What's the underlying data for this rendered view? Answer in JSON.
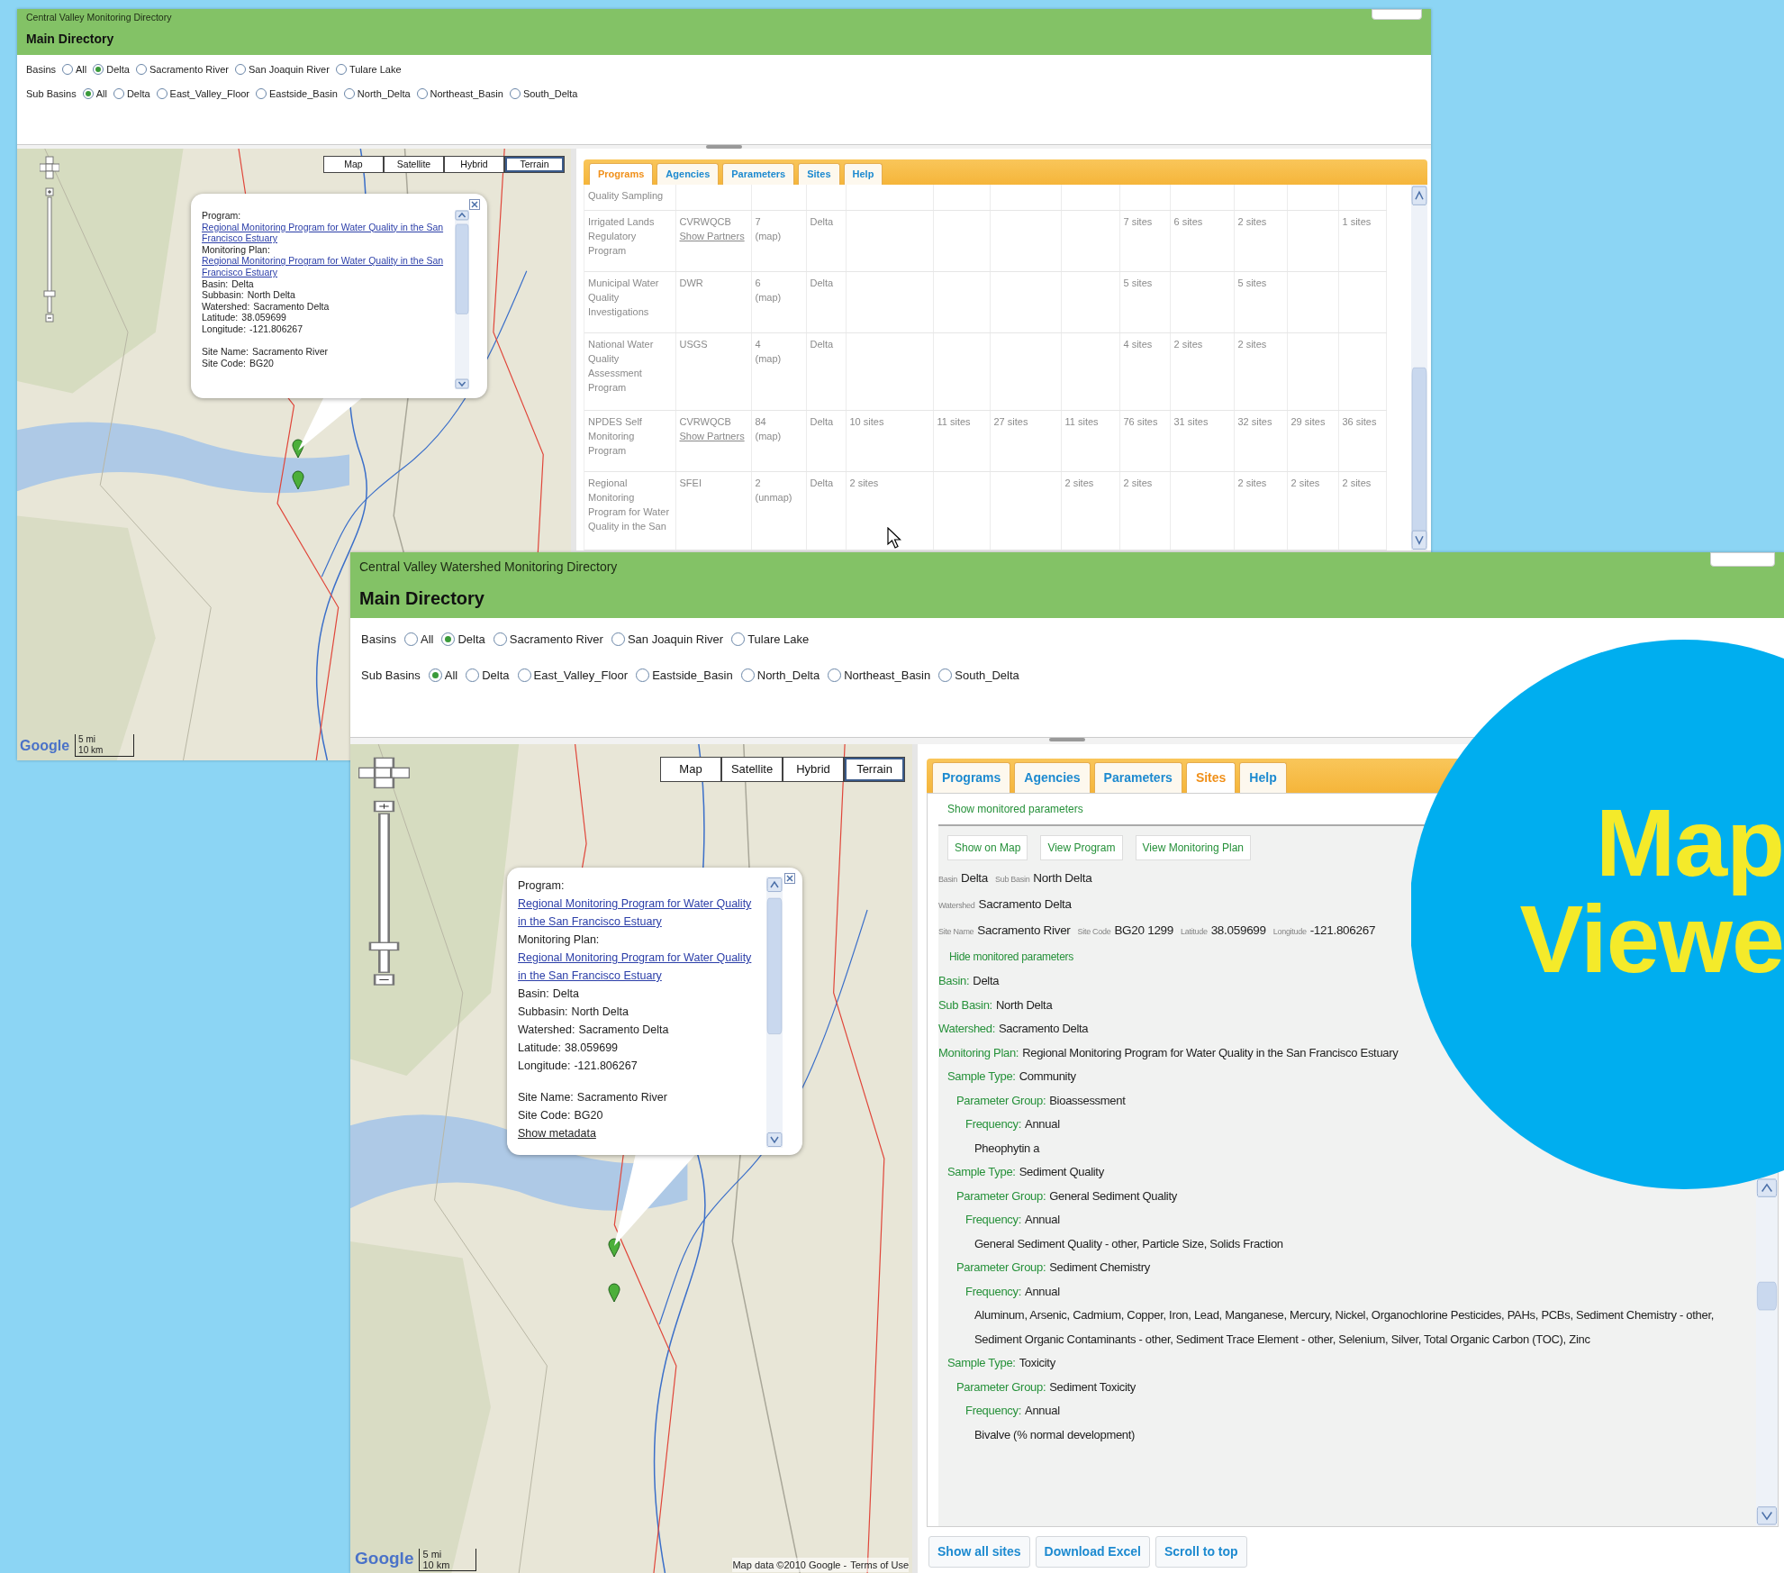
{
  "windows": [
    {
      "title": "Central Valley Monitoring Directory",
      "heading": "Main Directory",
      "filters": [
        {
          "label": "Basins",
          "options": [
            {
              "label": "All",
              "selected": false
            },
            {
              "label": "Delta",
              "selected": true
            },
            {
              "label": "Sacramento River",
              "selected": false
            },
            {
              "label": "San Joaquin River",
              "selected": false
            },
            {
              "label": "Tulare Lake",
              "selected": false
            }
          ]
        },
        {
          "label": "Sub Basins",
          "options": [
            {
              "label": "All",
              "selected": true
            },
            {
              "label": "Delta",
              "selected": false
            },
            {
              "label": "East_Valley_Floor",
              "selected": false
            },
            {
              "label": "Eastside_Basin",
              "selected": false
            },
            {
              "label": "North_Delta",
              "selected": false
            },
            {
              "label": "Northeast_Basin",
              "selected": false
            },
            {
              "label": "South_Delta",
              "selected": false
            }
          ]
        }
      ],
      "map": {
        "map_types": [
          {
            "label": "Map",
            "selected": false
          },
          {
            "label": "Satellite",
            "selected": false
          },
          {
            "label": "Hybrid",
            "selected": false
          },
          {
            "label": "Terrain",
            "selected": true
          }
        ],
        "popup": [
          {
            "kind": "link",
            "label": "Program:",
            "value": "Regional Monitoring Program for Water Quality in the San Francisco Estuary"
          },
          {
            "kind": "link",
            "label": "Monitoring Plan:",
            "value": "Regional Monitoring Program for Water Quality in the San Francisco Estuary"
          },
          {
            "kind": "text",
            "label": "Basin:",
            "value": "Delta"
          },
          {
            "kind": "text",
            "label": "Subbasin:",
            "value": "North Delta"
          },
          {
            "kind": "text",
            "label": "Watershed:",
            "value": "Sacramento Delta"
          },
          {
            "kind": "text",
            "label": "Latitude:",
            "value": "38.059699"
          },
          {
            "kind": "text",
            "label": "Longitude:",
            "value": "-121.806267"
          },
          {
            "kind": "gap"
          },
          {
            "kind": "text",
            "label": "Site Name:",
            "value": "Sacramento River"
          },
          {
            "kind": "text",
            "label": "Site Code:",
            "value": "BG20"
          }
        ],
        "logo": "Google",
        "scale_miles": "5 mi",
        "scale_km": "10 km"
      },
      "panel": {
        "kind": "programs",
        "tabs": [
          {
            "label": "Programs",
            "selected": true
          },
          {
            "label": "Agencies",
            "selected": false
          },
          {
            "label": "Parameters",
            "selected": false
          },
          {
            "label": "Sites",
            "selected": false
          },
          {
            "label": "Help",
            "selected": false
          }
        ],
        "rows": [
          {
            "program": "Quality Sampling"
          },
          {
            "program": "Irrigated Lands Regulatory Program",
            "agency": "CVRWQCB",
            "partners_link": "Show Partners",
            "count": "7",
            "map_link": "(map)",
            "basin": "Delta",
            "column_5": "7 sites",
            "column_6": "6 sites",
            "column_7": "2 sites",
            "column_9": "1 sites"
          },
          {
            "program": "Municipal Water Quality Investigations",
            "agency": "DWR",
            "count": "6",
            "map_link": "(map)",
            "basin": "Delta",
            "column_5": "5 sites",
            "column_7": "5 sites"
          },
          {
            "program": "National Water Quality Assessment Program",
            "agency": "USGS",
            "count": "4",
            "map_link": "(map)",
            "basin": "Delta",
            "column_5": "4 sites",
            "column_6": "2 sites",
            "column_7": "2 sites"
          },
          {
            "program": "NPDES Self Monitoring Program",
            "agency": "CVRWQCB",
            "partners_link": "Show Partners",
            "count": "84",
            "map_link": "(map)",
            "basin": "Delta",
            "column_1": "10 sites",
            "column_2": "11 sites",
            "column_3": "27 sites",
            "column_4": "11 sites",
            "column_5": "76 sites",
            "column_6": "31 sites",
            "column_7": "32 sites",
            "column_8": "29 sites",
            "column_9": "36 sites"
          },
          {
            "program": "Regional Monitoring Program for Water Quality in the San",
            "agency": "SFEI",
            "count": "2",
            "map_link": "(unmap)",
            "basin": "Delta",
            "column_1": "2 sites",
            "column_4": "2 sites",
            "column_5": "2 sites",
            "column_7": "2 sites",
            "column_8": "2 sites",
            "column_9": "2 sites"
          }
        ]
      }
    },
    {
      "title": "Central Valley Watershed Monitoring Directory",
      "heading": "Main Directory",
      "filters": [
        {
          "label": "Basins",
          "options": [
            {
              "label": "All",
              "selected": false
            },
            {
              "label": "Delta",
              "selected": true
            },
            {
              "label": "Sacramento River",
              "selected": false
            },
            {
              "label": "San Joaquin River",
              "selected": false
            },
            {
              "label": "Tulare Lake",
              "selected": false
            }
          ]
        },
        {
          "label": "Sub Basins",
          "options": [
            {
              "label": "All",
              "selected": true
            },
            {
              "label": "Delta",
              "selected": false
            },
            {
              "label": "East_Valley_Floor",
              "selected": false
            },
            {
              "label": "Eastside_Basin",
              "selected": false
            },
            {
              "label": "North_Delta",
              "selected": false
            },
            {
              "label": "Northeast_Basin",
              "selected": false
            },
            {
              "label": "South_Delta",
              "selected": false
            }
          ]
        }
      ],
      "map": {
        "map_types": [
          {
            "label": "Map",
            "selected": false
          },
          {
            "label": "Satellite",
            "selected": false
          },
          {
            "label": "Hybrid",
            "selected": false
          },
          {
            "label": "Terrain",
            "selected": true
          }
        ],
        "popup": [
          {
            "kind": "link",
            "label": "Program:",
            "value": "Regional Monitoring Program for Water Quality in the San Francisco Estuary"
          },
          {
            "kind": "link",
            "label": "Monitoring Plan:",
            "value": "Regional Monitoring Program for Water Quality in the San Francisco Estuary"
          },
          {
            "kind": "text",
            "label": "Basin:",
            "value": "Delta"
          },
          {
            "kind": "text",
            "label": "Subbasin:",
            "value": "North Delta"
          },
          {
            "kind": "text",
            "label": "Watershed:",
            "value": "Sacramento Delta"
          },
          {
            "kind": "text",
            "label": "Latitude:",
            "value": "38.059699"
          },
          {
            "kind": "text",
            "label": "Longitude:",
            "value": "-121.806267"
          },
          {
            "kind": "gap"
          },
          {
            "kind": "text",
            "label": "Site Name:",
            "value": "Sacramento River"
          },
          {
            "kind": "text",
            "label": "Site Code:",
            "value": "BG20"
          },
          {
            "kind": "action",
            "value": "Show metadata"
          }
        ],
        "logo": "Google",
        "scale_miles": "5 mi",
        "scale_km": "10 km",
        "attribution": "Map data ©2010 Google -",
        "terms_link": "Terms of Use"
      },
      "panel": {
        "kind": "sites",
        "tabs": [
          {
            "label": "Programs",
            "selected": false
          },
          {
            "label": "Agencies",
            "selected": false
          },
          {
            "label": "Parameters",
            "selected": false
          },
          {
            "label": "Sites",
            "selected": true
          },
          {
            "label": "Help",
            "selected": false
          }
        ],
        "show_link": "Show monitored parameters",
        "buttons": [
          "Show on Map",
          "View Program",
          "View Monitoring Plan"
        ],
        "summary": [
          [
            {
              "label": "Basin",
              "value": "Delta"
            },
            {
              "label": "Sub Basin",
              "value": "North Delta"
            }
          ],
          [
            {
              "label": "Watershed",
              "value": "Sacramento Delta"
            }
          ],
          [
            {
              "label": "Site Name",
              "value": "Sacramento River"
            },
            {
              "label": "Site Code",
              "value": "BG20 1299"
            },
            {
              "label": "Latitude",
              "value": "38.059699"
            },
            {
              "label": "Longitude",
              "value": "-121.806267"
            }
          ]
        ],
        "hide_link": "Hide monitored parameters",
        "details": [
          {
            "label": "Basin:",
            "value": "Delta"
          },
          {
            "label": "Sub Basin:",
            "value": "North Delta"
          },
          {
            "label": "Watershed:",
            "value": "Sacramento Delta"
          },
          {
            "label": "Monitoring Plan:",
            "value": "Regional Monitoring Program for Water Quality in the San Francisco Estuary"
          }
        ],
        "tree": [
          {
            "label": "Sample Type:",
            "value": "Community",
            "children": [
              {
                "label": "Parameter Group:",
                "value": "Bioassessment",
                "children": [
                  {
                    "label": "Frequency:",
                    "value": "Annual",
                    "children": [
                      {
                        "text": "Pheophytin a"
                      }
                    ]
                  }
                ]
              }
            ]
          },
          {
            "label": "Sample Type:",
            "value": "Sediment Quality",
            "children": [
              {
                "label": "Parameter Group:",
                "value": "General Sediment Quality",
                "children": [
                  {
                    "label": "Frequency:",
                    "value": "Annual",
                    "children": [
                      {
                        "text": "General Sediment Quality - other, Particle Size, Solids Fraction"
                      }
                    ]
                  }
                ]
              },
              {
                "label": "Parameter Group:",
                "value": "Sediment Chemistry",
                "children": [
                  {
                    "label": "Frequency:",
                    "value": "Annual",
                    "children": [
                      {
                        "text": "Aluminum, Arsenic, Cadmium, Copper, Iron, Lead, Manganese, Mercury, Nickel, Organochlorine Pesticides, PAHs, PCBs, Sediment Chemistry - other, Sediment Organic Contaminants - other, Sediment Trace Element - other, Selenium, Silver, Total Organic Carbon (TOC), Zinc"
                      }
                    ]
                  }
                ]
              }
            ]
          },
          {
            "label": "Sample Type:",
            "value": "Toxicity",
            "children": [
              {
                "label": "Parameter Group:",
                "value": "Sediment Toxicity",
                "children": [
                  {
                    "label": "Frequency:",
                    "value": "Annual",
                    "children": [
                      {
                        "text": "Bivalve (% normal development)"
                      }
                    ]
                  }
                ]
              }
            ]
          }
        ],
        "footer_buttons": [
          "Show all sites",
          "Download Excel",
          "Scroll to top"
        ]
      }
    }
  ],
  "overlay": {
    "title": "Map Viewe"
  }
}
